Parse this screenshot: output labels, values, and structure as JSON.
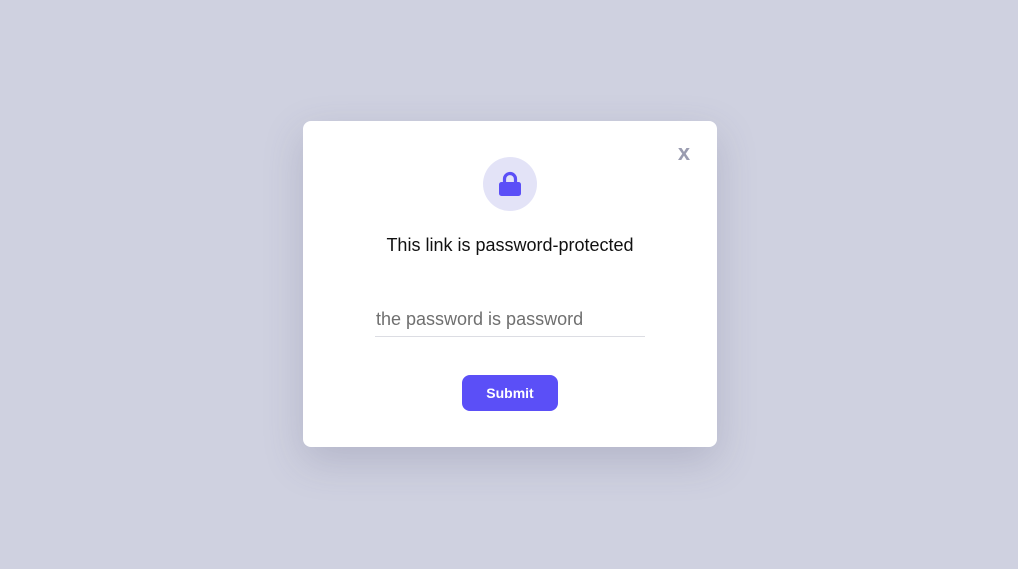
{
  "modal": {
    "close_label": "x",
    "lock_icon": "lock-icon",
    "title": "This link is password-protected",
    "password": {
      "value": "",
      "placeholder": "the password is password"
    },
    "submit_label": "Submit"
  },
  "colors": {
    "background": "#cfd1e0",
    "accent": "#5b4ff7",
    "icon_circle": "#e3e3f7",
    "close": "#9a9cb0"
  }
}
